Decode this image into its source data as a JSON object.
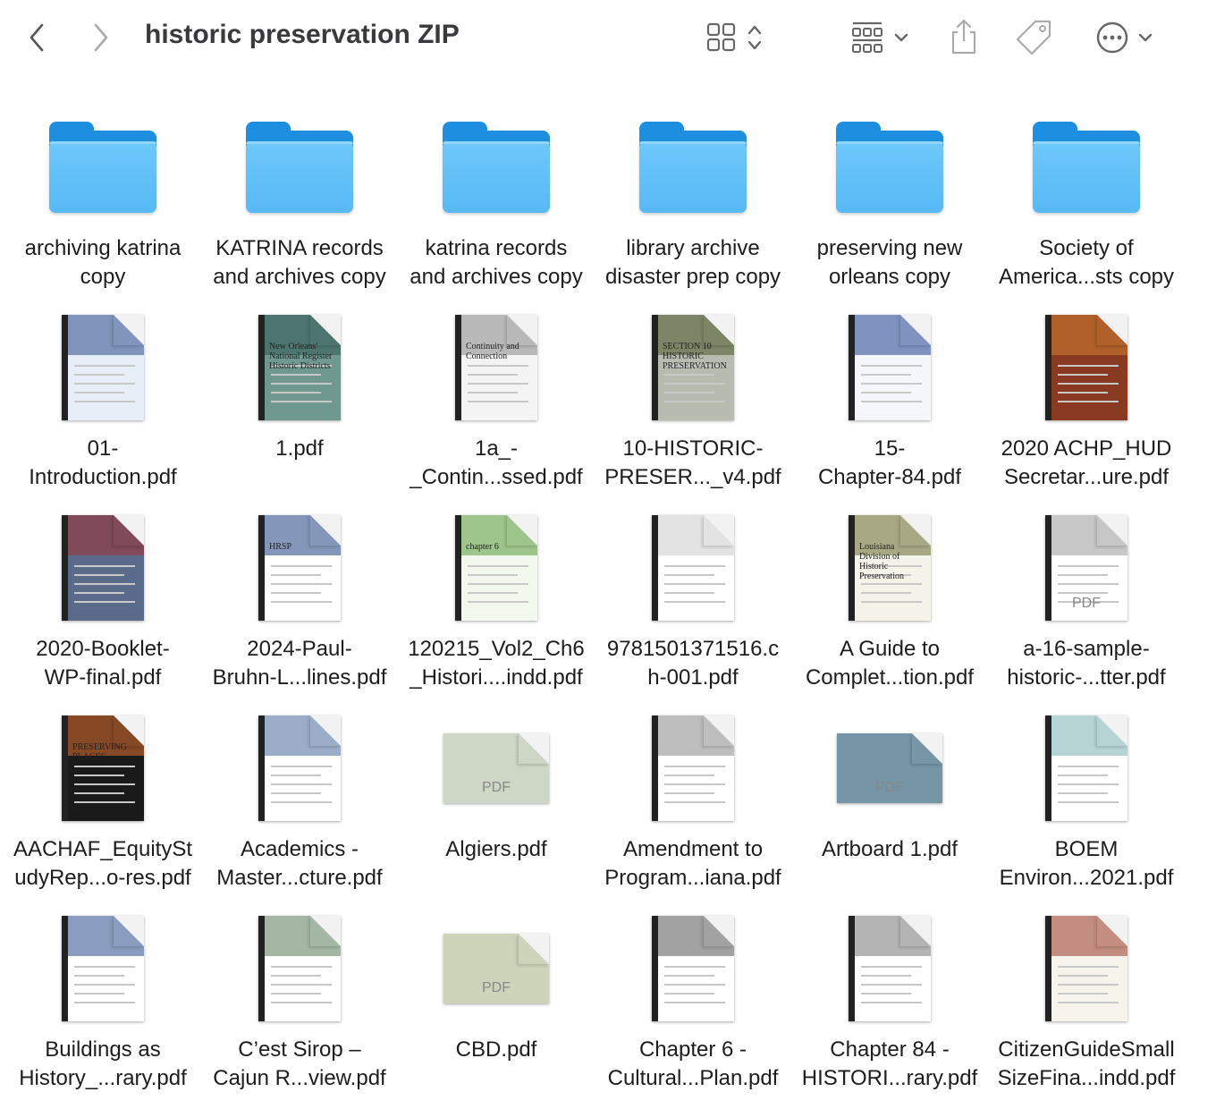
{
  "window": {
    "title": "historic preservation ZIP"
  },
  "toolbar": {
    "back_icon": "chevron-left-icon",
    "forward_icon": "chevron-right-icon",
    "view_icon": "grid-view-icon",
    "group_icon": "group-by-icon",
    "share_icon": "share-icon",
    "tag_icon": "tag-icon",
    "more_icon": "more-actions-icon"
  },
  "items": [
    {
      "kind": "folder",
      "label": "archiving katrina\ncopy"
    },
    {
      "kind": "folder",
      "label": "KATRINA records\nand archives  copy"
    },
    {
      "kind": "folder",
      "label": "katrina records\nand archives copy"
    },
    {
      "kind": "folder",
      "label": "library archive\ndisaster prep copy"
    },
    {
      "kind": "folder",
      "label": "preserving new\norleans copy"
    },
    {
      "kind": "folder",
      "label": "Society of\nAmerica...sts copy"
    },
    {
      "kind": "pdf",
      "label": "01-\nIntroduction.pdf",
      "cover": "#e8eef8",
      "accent": "#2a4a8a"
    },
    {
      "kind": "pdf",
      "label": "1.pdf",
      "cover": "#6f9890",
      "accent": "#2d5a52",
      "cover_text": "New Orleans' National Register Historic Districts"
    },
    {
      "kind": "pdf",
      "label": "1a_-\n_Contin...ssed.pdf",
      "cover": "#f4f4f4",
      "accent": "#888888",
      "cover_text": "Continuity and Connection"
    },
    {
      "kind": "pdf",
      "label": "10-HISTORIC-\nPRESER..._v4.pdf",
      "cover": "#b8bcb0",
      "accent": "#4a5a2a",
      "cover_text": "SECTION 10 HISTORIC PRESERVATION"
    },
    {
      "kind": "pdf",
      "label": "15-\nChapter-84.pdf",
      "cover": "#f4f6fb",
      "accent": "#1f3f8f"
    },
    {
      "kind": "pdf",
      "label": "2020 ACHP_HUD\nSecretar...ure.pdf",
      "cover": "#8a3a20",
      "accent": "#d08030"
    },
    {
      "kind": "pdf",
      "label": "2020-Booklet-\nWP-final.pdf",
      "cover": "#5a6a8a",
      "accent": "#a03030"
    },
    {
      "kind": "pdf",
      "label": "2024-Paul-\nBruhn-L...lines.pdf",
      "cover": "#ffffff",
      "accent": "#1f3f7f",
      "cover_text": "HRSP"
    },
    {
      "kind": "pdf",
      "label": "120215_Vol2_Ch6\n_Histori....indd.pdf",
      "cover": "#f2f8ee",
      "accent": "#5a9a3a",
      "cover_text": "chapter 6"
    },
    {
      "kind": "pdf",
      "label": "9781501371516.c\nh-001.pdf",
      "cover": "#ffffff",
      "accent": "#cccccc"
    },
    {
      "kind": "pdf",
      "label": "A Guide to\nComplet...tion.pdf",
      "cover": "#f3f3ea",
      "accent": "#6a6a30",
      "cover_text": "Louisiana Division of Historic Preservation"
    },
    {
      "kind": "pdf",
      "label": "a-16-sample-\nhistoric-...tter.pdf",
      "cover": "#ffffff",
      "accent": "#999999",
      "pdf_label": "PDF"
    },
    {
      "kind": "pdf",
      "label": "AACHAF_EquitySt\nudyRep...o-res.pdf",
      "cover": "#1a1a1a",
      "accent": "#e07030",
      "cover_text": "PRESERVING PLACES"
    },
    {
      "kind": "pdf",
      "label": "Academics -\nMaster...cture.pdf",
      "cover": "#ffffff",
      "accent": "#4a6a9a"
    },
    {
      "kind": "pdf",
      "label": "Algiers.pdf",
      "cover": "#efe6c0",
      "accent": "#6aaad8",
      "pdf_label": "PDF",
      "landscape": true
    },
    {
      "kind": "pdf",
      "label": "Amendment to\nProgram...iana.pdf",
      "cover": "#ffffff",
      "accent": "#888888"
    },
    {
      "kind": "pdf",
      "label": "Artboard 1.pdf",
      "cover": "#8aa0a8",
      "accent": "#3a78a8",
      "pdf_label": "PDF",
      "landscape": true
    },
    {
      "kind": "pdf",
      "label": "BOEM\nEnviron...2021.pdf",
      "cover": "#ffffff",
      "accent": "#7ab0b0"
    },
    {
      "kind": "pdf",
      "label": "Buildings as\nHistory_...rary.pdf",
      "cover": "#ffffff",
      "accent": "#2a4a8a"
    },
    {
      "kind": "pdf",
      "label": "C’est Sirop –\nCajun R...view.pdf",
      "cover": "#ffffff",
      "accent": "#5a7a5a"
    },
    {
      "kind": "pdf",
      "label": "CBD.pdf",
      "cover": "#efe2b0",
      "accent": "#6aaad8",
      "pdf_label": "PDF",
      "landscape": true
    },
    {
      "kind": "pdf",
      "label": "Chapter 6 -\nCultural...Plan.pdf",
      "cover": "#ffffff",
      "accent": "#555555"
    },
    {
      "kind": "pdf",
      "label": "Chapter 84 -\nHISTORI...rary.pdf",
      "cover": "#ffffff",
      "accent": "#777777"
    },
    {
      "kind": "pdf",
      "label": "CitizenGuideSmall\nSizeFina...indd.pdf",
      "cover": "#f6f2ec",
      "accent": "#9a3a2a"
    }
  ]
}
